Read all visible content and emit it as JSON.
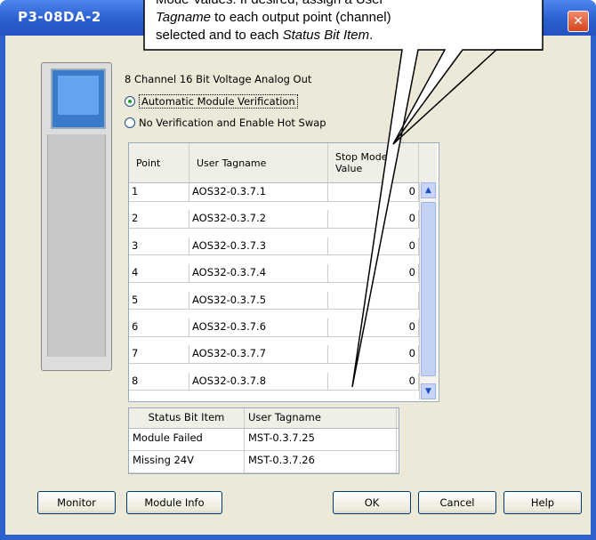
{
  "window": {
    "title": "P3-08DA-2",
    "close_glyph": "✕"
  },
  "module": {
    "description": "8 Channel 16 Bit Voltage Analog Out"
  },
  "verification": {
    "options": [
      {
        "label": "Automatic Module Verification",
        "selected": true
      },
      {
        "label": "No Verification and Enable Hot Swap",
        "selected": false
      }
    ]
  },
  "output_table": {
    "headers": [
      "Point",
      "User Tagname",
      "Stop Mode Value"
    ],
    "rows": [
      {
        "point": "1",
        "tag": "AOS32-0.3.7.1",
        "value": "0"
      },
      {
        "point": "2",
        "tag": "AOS32-0.3.7.2",
        "value": "0"
      },
      {
        "point": "3",
        "tag": "AOS32-0.3.7.3",
        "value": "0"
      },
      {
        "point": "4",
        "tag": "AOS32-0.3.7.4",
        "value": "0"
      },
      {
        "point": "5",
        "tag": "AOS32-0.3.7.5",
        "value": ""
      },
      {
        "point": "6",
        "tag": "AOS32-0.3.7.6",
        "value": "0"
      },
      {
        "point": "7",
        "tag": "AOS32-0.3.7.7",
        "value": "0"
      },
      {
        "point": "8",
        "tag": "AOS32-0.3.7.8",
        "value": "0"
      }
    ]
  },
  "status_table": {
    "headers": [
      "Status Bit Item",
      "User Tagname"
    ],
    "rows": [
      {
        "item": "Module Failed",
        "tag": "MST-0.3.7.25"
      },
      {
        "item": "Missing 24V",
        "tag": "MST-0.3.7.26"
      }
    ]
  },
  "buttons": {
    "monitor": "Monitor",
    "module_info": "Module Info",
    "ok": "OK",
    "cancel": "Cancel",
    "help": "Help"
  },
  "callout": {
    "line1": "Mode Values. If desired, assign a User",
    "line2_em": "Tagname",
    "line2_rest": " to each output point (channel)",
    "line3_start": "selected and to each ",
    "line3_em": "Status Bit Item",
    "line3_end": "."
  },
  "colors": {
    "titlebar": "#2b5fd0",
    "dialog_bg": "#ece9d8",
    "close": "#d3451f"
  }
}
